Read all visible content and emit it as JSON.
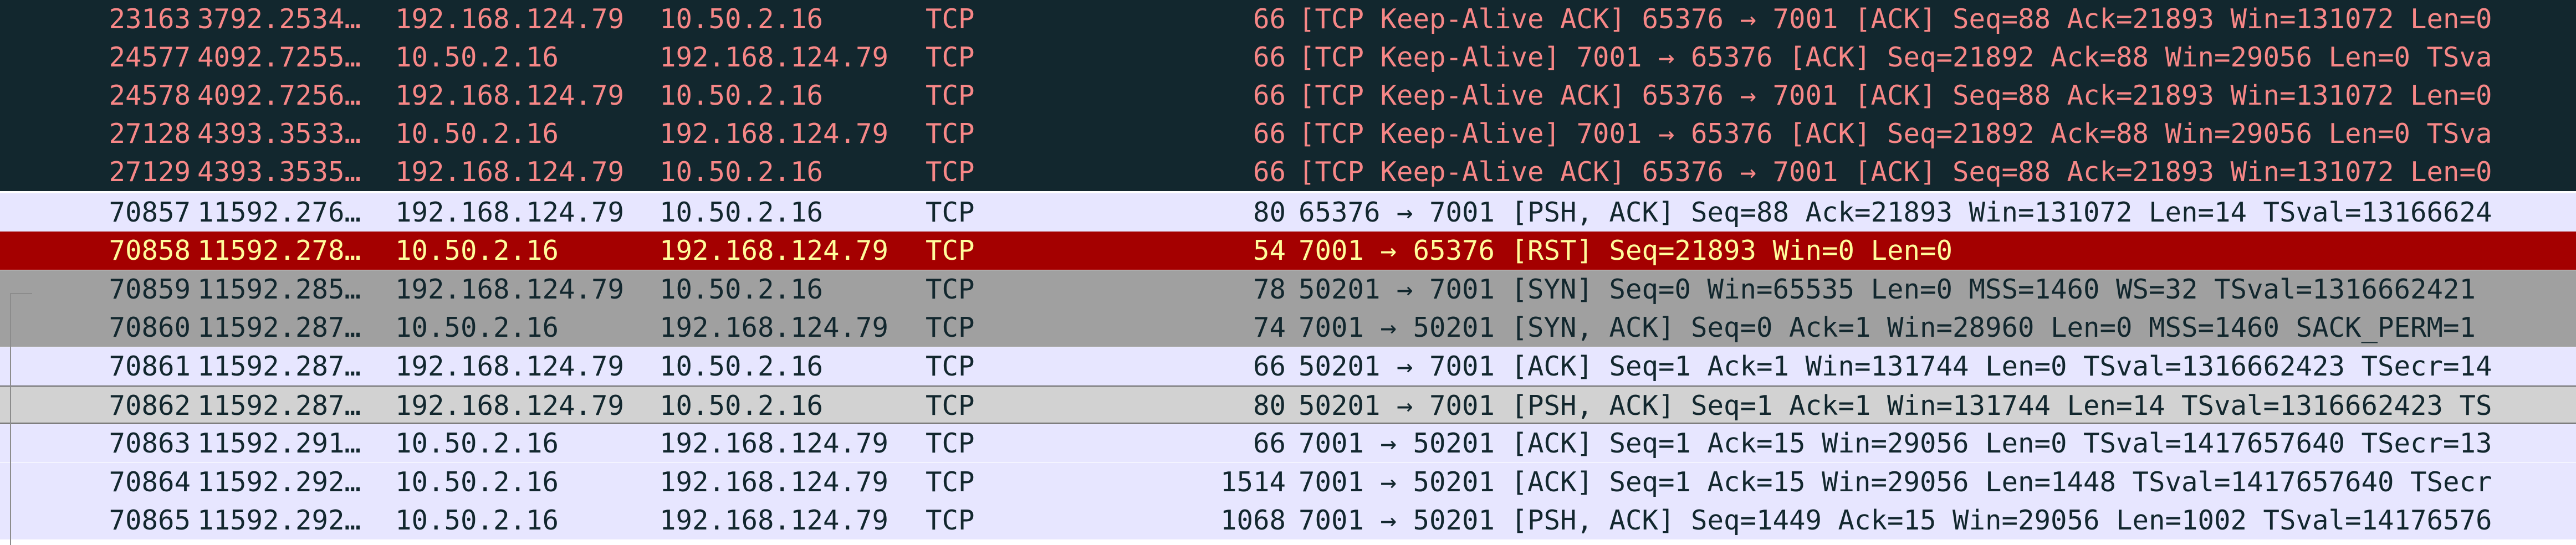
{
  "packet_list": {
    "rows": [
      {
        "style": "keepalive",
        "no": "23163",
        "time": "3792.2534…",
        "source": "192.168.124.79",
        "destination": "10.50.2.16",
        "protocol": "TCP",
        "length": "66",
        "info": "[TCP Keep-Alive ACK] 65376 → 7001 [ACK] Seq=88 Ack=21893 Win=131072 Len=0"
      },
      {
        "style": "keepalive",
        "no": "24577",
        "time": "4092.7255…",
        "source": "10.50.2.16",
        "destination": "192.168.124.79",
        "protocol": "TCP",
        "length": "66",
        "info": "[TCP Keep-Alive] 7001 → 65376 [ACK] Seq=21892 Ack=88 Win=29056 Len=0 TSva"
      },
      {
        "style": "keepalive",
        "no": "24578",
        "time": "4092.7256…",
        "source": "192.168.124.79",
        "destination": "10.50.2.16",
        "protocol": "TCP",
        "length": "66",
        "info": "[TCP Keep-Alive ACK] 65376 → 7001 [ACK] Seq=88 Ack=21893 Win=131072 Len=0"
      },
      {
        "style": "keepalive",
        "no": "27128",
        "time": "4393.3533…",
        "source": "10.50.2.16",
        "destination": "192.168.124.79",
        "protocol": "TCP",
        "length": "66",
        "info": "[TCP Keep-Alive] 7001 → 65376 [ACK] Seq=21892 Ack=88 Win=29056 Len=0 TSva"
      },
      {
        "style": "keepalive",
        "no": "27129",
        "time": "4393.3535…",
        "source": "192.168.124.79",
        "destination": "10.50.2.16",
        "protocol": "TCP",
        "length": "66",
        "info": "[TCP Keep-Alive ACK] 65376 → 7001 [ACK] Seq=88 Ack=21893 Win=131072 Len=0"
      },
      {
        "style": "tcp",
        "no": "70857",
        "time": "11592.276…",
        "source": "192.168.124.79",
        "destination": "10.50.2.16",
        "protocol": "TCP",
        "length": "80",
        "info": "65376 → 7001 [PSH, ACK] Seq=88 Ack=21893 Win=131072 Len=14 TSval=13166624"
      },
      {
        "style": "rst",
        "no": "70858",
        "time": "11592.278…",
        "source": "10.50.2.16",
        "destination": "192.168.124.79",
        "protocol": "TCP",
        "length": "54",
        "info": "7001 → 65376 [RST] Seq=21893 Win=0 Len=0"
      },
      {
        "style": "syn",
        "no": "70859",
        "time": "11592.285…",
        "source": "192.168.124.79",
        "destination": "10.50.2.16",
        "protocol": "TCP",
        "length": "78",
        "info": "50201 → 7001 [SYN] Seq=0 Win=65535 Len=0 MSS=1460 WS=32 TSval=1316662421"
      },
      {
        "style": "syn",
        "no": "70860",
        "time": "11592.287…",
        "source": "10.50.2.16",
        "destination": "192.168.124.79",
        "protocol": "TCP",
        "length": "74",
        "info": "7001 → 50201 [SYN, ACK] Seq=0 Ack=1 Win=28960 Len=0 MSS=1460 SACK_PERM=1"
      },
      {
        "style": "tcp",
        "no": "70861",
        "time": "11592.287…",
        "source": "192.168.124.79",
        "destination": "10.50.2.16",
        "protocol": "TCP",
        "length": "66",
        "info": "50201 → 7001 [ACK] Seq=1 Ack=1 Win=131744 Len=0 TSval=1316662423 TSecr=14"
      },
      {
        "style": "selected",
        "no": "70862",
        "time": "11592.287…",
        "source": "192.168.124.79",
        "destination": "10.50.2.16",
        "protocol": "TCP",
        "length": "80",
        "info": "50201 → 7001 [PSH, ACK] Seq=1 Ack=1 Win=131744 Len=14 TSval=1316662423 TS"
      },
      {
        "style": "tcp",
        "no": "70863",
        "time": "11592.291…",
        "source": "10.50.2.16",
        "destination": "192.168.124.79",
        "protocol": "TCP",
        "length": "66",
        "info": "7001 → 50201 [ACK] Seq=1 Ack=15 Win=29056 Len=0 TSval=1417657640 TSecr=13"
      },
      {
        "style": "tcp",
        "no": "70864",
        "time": "11592.292…",
        "source": "10.50.2.16",
        "destination": "192.168.124.79",
        "protocol": "TCP",
        "length": "1514",
        "info": "7001 → 50201 [ACK] Seq=1 Ack=15 Win=29056 Len=1448 TSval=1417657640 TSecr"
      },
      {
        "style": "tcp",
        "no": "70865",
        "time": "11592.292…",
        "source": "10.50.2.16",
        "destination": "192.168.124.79",
        "protocol": "TCP",
        "length": "1068",
        "info": "7001 → 50201 [PSH, ACK] Seq=1449 Ack=15 Win=29056 Len=1002 TSval=14176576"
      }
    ]
  }
}
